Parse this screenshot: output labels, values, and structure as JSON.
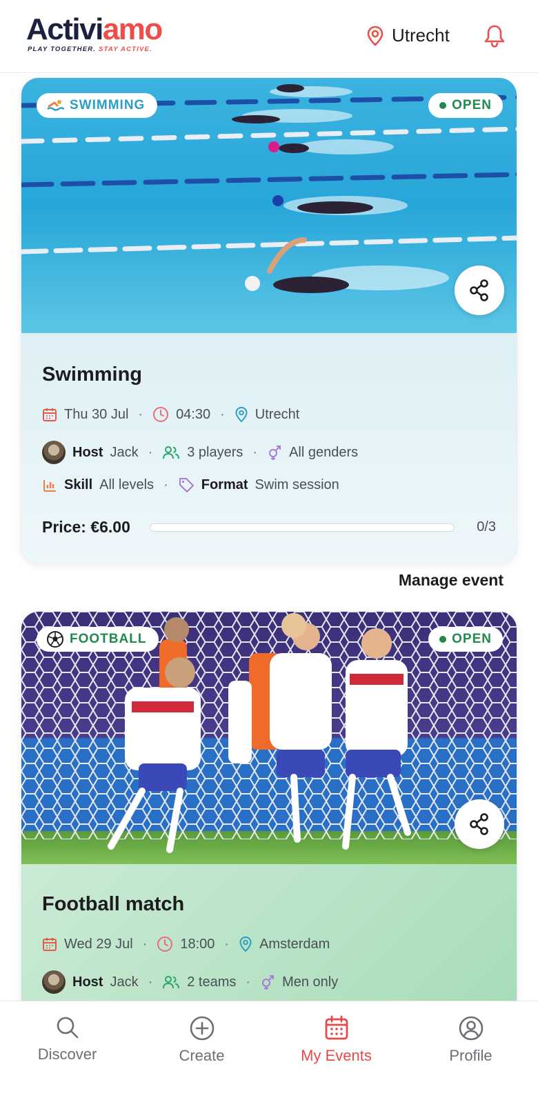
{
  "header": {
    "logo_part1": "Activi",
    "logo_part2": "amo",
    "tagline_part1": "PLAY TOGETHER.",
    "tagline_part2": "STAY ACTIVE.",
    "location": "Utrecht",
    "location_icon": "map-pin-icon",
    "bell_icon": "bell-icon"
  },
  "colors": {
    "brand_dark": "#1d2140",
    "brand_red": "#ee4d4a",
    "status_green": "#1f8a4c",
    "active_tab": "#e84848"
  },
  "events": [
    {
      "sport_label": "SWIMMING",
      "sport_icon": "swimmer-icon",
      "status": "OPEN",
      "title": "Swimming",
      "date": "Thu 30 Jul",
      "time": "04:30",
      "location": "Utrecht",
      "host_label": "Host",
      "host_name": "Jack",
      "players": "3 players",
      "gender": "All genders",
      "skill_label": "Skill",
      "skill_value": "All levels",
      "format_label": "Format",
      "format_value": "Swim session",
      "price": "Price: €6.00",
      "filled_fraction": 0,
      "count": "0/3",
      "accent": "#2a9ec4"
    },
    {
      "sport_label": "FOOTBALL",
      "sport_icon": "soccer-ball-icon",
      "status": "OPEN",
      "title": "Football match",
      "date": "Wed 29 Jul",
      "time": "18:00",
      "location": "Amsterdam",
      "host_label": "Host",
      "host_name": "Jack",
      "players": "2 teams",
      "gender": "Men only",
      "accent": "#1f8a4c"
    }
  ],
  "manage_event": "Manage event",
  "tabs": [
    {
      "label": "Discover",
      "icon": "search-icon"
    },
    {
      "label": "Create",
      "icon": "plus-circle-icon"
    },
    {
      "label": "My Events",
      "icon": "calendar-icon"
    },
    {
      "label": "Profile",
      "icon": "user-circle-icon"
    }
  ]
}
